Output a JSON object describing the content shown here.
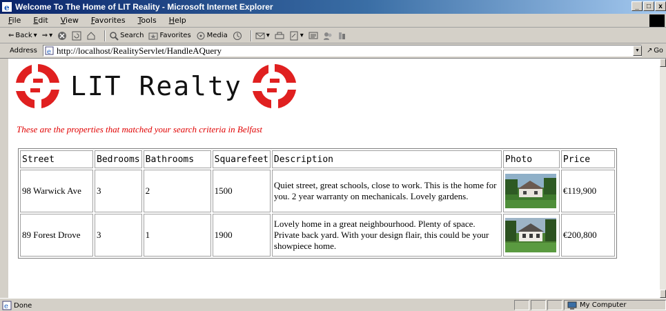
{
  "window": {
    "title": "Welcome To The Home of LIT Reality - Microsoft Internet Explorer"
  },
  "menu": [
    "File",
    "Edit",
    "View",
    "Favorites",
    "Tools",
    "Help"
  ],
  "toolbar": {
    "back": "Back",
    "search": "Search",
    "favorites": "Favorites",
    "media": "Media"
  },
  "address": {
    "label": "Address",
    "url": "http://localhost/RealityServlet/HandleAQuery",
    "go": "Go"
  },
  "page": {
    "brand": "LIT Realty",
    "subtitle": "These are the properties that matched your search criteria in Belfast",
    "columns": [
      "Street",
      "Bedrooms",
      "Bathrooms",
      "Squarefeet",
      "Description",
      "Photo",
      "Price"
    ],
    "rows": [
      {
        "street": "98 Warwick Ave",
        "bedrooms": "3",
        "bathrooms": "2",
        "squarefeet": "1500",
        "description": "Quiet street, great schools, close to work. This is the home for you. 2 year warranty on mechanicals. Lovely gardens.",
        "price": "€119,900"
      },
      {
        "street": "89 Forest Drove",
        "bedrooms": "3",
        "bathrooms": "1",
        "squarefeet": "1900",
        "description": "Lovely home in a great neighbourhood. Plenty of space. Private back yard. With your design flair, this could be your showpiece home.",
        "price": "€200,800"
      }
    ]
  },
  "status": {
    "text": "Done",
    "zone": "My Computer"
  },
  "colors": {
    "titlebar": "#0a246a",
    "logo_red": "#e02020",
    "subtitle_red": "#e00000"
  }
}
